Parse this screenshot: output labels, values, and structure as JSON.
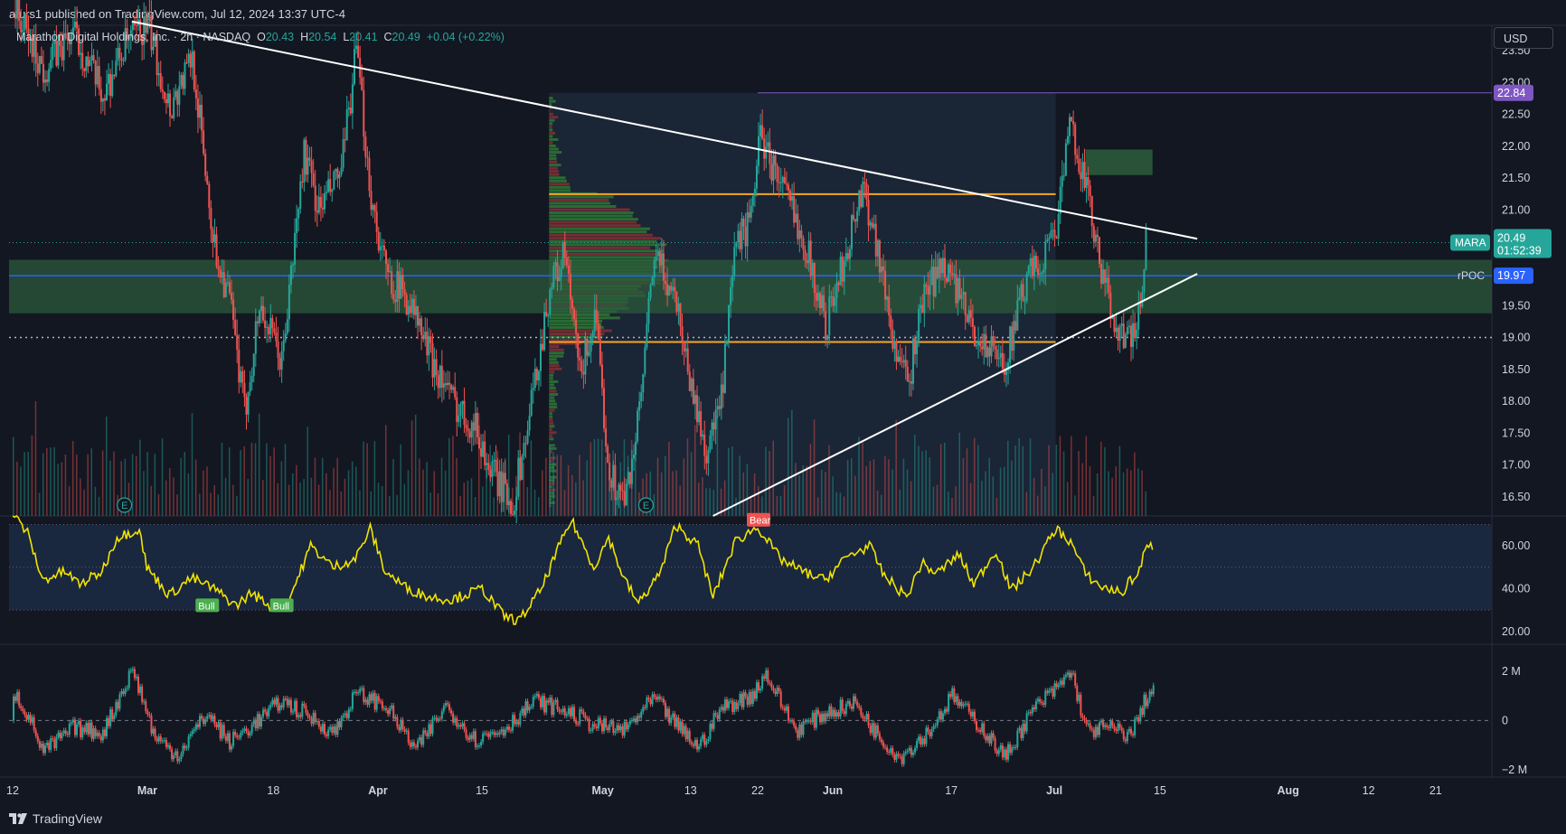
{
  "header": {
    "published": "afurs1 published on TradingView.com, Jul 12, 2024 13:37 UTC-4",
    "currency": "USD"
  },
  "legend": {
    "symbol": "Marathon Digital Holdings, Inc. · 2h · NASDAQ",
    "o_label": "O",
    "o_val": "20.43",
    "h_label": "H",
    "h_val": "20.54",
    "l_label": "L",
    "l_val": "20.41",
    "c_label": "C",
    "c_val": "20.49",
    "change": "+0.04 (+0.22%)"
  },
  "price_labels": {
    "last_symbol": "MARA",
    "last_price": "20.49",
    "countdown": "01:52:39",
    "rpoc_label": "rPOC",
    "rpoc_price": "19.97",
    "high_price": "22.84"
  },
  "rsi_labels": {
    "bull1": "Bull",
    "bull2": "Bull",
    "bear": "Bear"
  },
  "footer": {
    "brand": "TradingView"
  },
  "colors": {
    "up": "#26a69a",
    "down": "#ef5350",
    "bg": "#131722",
    "rsi": "#f2e400",
    "purple": "#7e57c2",
    "orange": "#f5a623",
    "blue": "#2962ff"
  },
  "chart_data": [
    {
      "type": "candlestick",
      "panel": "price",
      "ylim": [
        16.2,
        23.9
      ],
      "y_ticks": [
        "23.50",
        "23.00",
        "22.50",
        "22.00",
        "21.50",
        "21.00",
        "20.50",
        "20.00",
        "19.50",
        "19.00",
        "18.50",
        "18.00",
        "17.50",
        "17.00",
        "16.50"
      ],
      "y_tick_values": [
        23.5,
        23.0,
        22.5,
        22.0,
        21.5,
        21.0,
        20.5,
        20.0,
        19.5,
        19.0,
        18.5,
        18.0,
        17.5,
        17.0,
        16.5
      ],
      "x_ticks": [
        "12",
        "Mar",
        "18",
        "Apr",
        "15",
        "May",
        "13",
        "22",
        "Jun",
        "17",
        "Jul",
        "15",
        "Aug",
        "12",
        "21"
      ],
      "x_tick_dates": [
        "2024-02-12",
        "2024-03-01",
        "2024-03-18",
        "2024-04-01",
        "2024-04-15",
        "2024-05-01",
        "2024-05-13",
        "2024-05-22",
        "2024-06-01",
        "2024-06-17",
        "2024-07-01",
        "2024-07-15",
        "2024-08-01",
        "2024-08-12",
        "2024-08-21"
      ],
      "keypoints": [
        [
          "2024-02-12",
          24.2
        ],
        [
          "2024-02-16",
          23.2
        ],
        [
          "2024-02-20",
          23.8
        ],
        [
          "2024-02-24",
          22.8
        ],
        [
          "2024-02-27",
          23.6
        ],
        [
          "2024-03-01",
          23.9
        ],
        [
          "2024-03-04",
          22.6
        ],
        [
          "2024-03-07",
          23.4
        ],
        [
          "2024-03-10",
          20.4
        ],
        [
          "2024-03-12",
          19.6
        ],
        [
          "2024-03-14",
          17.8
        ],
        [
          "2024-03-16",
          19.5
        ],
        [
          "2024-03-19",
          18.6
        ],
        [
          "2024-03-22",
          21.9
        ],
        [
          "2024-03-24",
          21.0
        ],
        [
          "2024-03-27",
          21.6
        ],
        [
          "2024-03-29",
          23.5
        ],
        [
          "2024-03-31",
          21.2
        ],
        [
          "2024-04-02",
          20.0
        ],
        [
          "2024-04-05",
          19.6
        ],
        [
          "2024-04-08",
          18.7
        ],
        [
          "2024-04-11",
          18.0
        ],
        [
          "2024-04-14",
          17.6
        ],
        [
          "2024-04-16",
          16.9
        ],
        [
          "2024-04-19",
          16.4
        ],
        [
          "2024-04-21",
          17.6
        ],
        [
          "2024-04-24",
          19.8
        ],
        [
          "2024-04-26",
          20.3
        ],
        [
          "2024-04-28",
          18.4
        ],
        [
          "2024-04-30",
          19.3
        ],
        [
          "2024-05-02",
          16.9
        ],
        [
          "2024-05-04",
          16.4
        ],
        [
          "2024-05-06",
          17.8
        ],
        [
          "2024-05-08",
          20.3
        ],
        [
          "2024-05-11",
          19.6
        ],
        [
          "2024-05-13",
          18.2
        ],
        [
          "2024-05-15",
          17.2
        ],
        [
          "2024-05-17",
          18.0
        ],
        [
          "2024-05-19",
          20.5
        ],
        [
          "2024-05-21",
          20.8
        ],
        [
          "2024-05-22",
          22.2
        ],
        [
          "2024-05-25",
          21.4
        ],
        [
          "2024-05-28",
          20.6
        ],
        [
          "2024-05-31",
          19.2
        ],
        [
          "2024-06-02",
          20.0
        ],
        [
          "2024-06-05",
          21.4
        ],
        [
          "2024-06-07",
          20.4
        ],
        [
          "2024-06-09",
          19.0
        ],
        [
          "2024-06-11",
          18.2
        ],
        [
          "2024-06-13",
          19.6
        ],
        [
          "2024-06-16",
          20.2
        ],
        [
          "2024-06-19",
          19.3
        ],
        [
          "2024-06-21",
          18.9
        ],
        [
          "2024-06-24",
          18.6
        ],
        [
          "2024-06-27",
          19.9
        ],
        [
          "2024-06-29",
          20.2
        ],
        [
          "2024-07-01",
          20.8
        ],
        [
          "2024-07-03",
          22.4
        ],
        [
          "2024-07-05",
          21.3
        ],
        [
          "2024-07-07",
          20.0
        ],
        [
          "2024-07-09",
          19.2
        ],
        [
          "2024-07-11",
          18.9
        ],
        [
          "2024-07-12",
          19.3
        ],
        [
          "2024-07-13",
          20.5
        ]
      ],
      "annotations": {
        "descending_trendline": [
          [
            "2024-02-28",
            23.96
          ],
          [
            "2024-07-20",
            20.55
          ]
        ],
        "ascending_trendline": [
          [
            "2024-05-16",
            16.2
          ],
          [
            "2024-07-20",
            20.0
          ]
        ],
        "horizontal_high": {
          "value": 22.84,
          "from": "2024-05-22"
        },
        "value_area_high": {
          "value": 21.25,
          "from": "2024-04-24",
          "to": "2024-07-01"
        },
        "value_area_low": {
          "value": 18.93,
          "from": "2024-04-24",
          "to": "2024-07-01"
        },
        "rpoc": 19.97,
        "dotted_support": 19.0,
        "last_price_line": 20.49,
        "green_zone": [
          19.38,
          20.22
        ],
        "green_box": {
          "from": "2024-07-05",
          "to": "2024-07-14",
          "top": 21.95,
          "bottom": 21.55
        }
      }
    },
    {
      "type": "line",
      "panel": "RSI",
      "ylim": [
        14,
        74
      ],
      "y_ticks": [
        "60.00",
        "40.00",
        "20.00"
      ],
      "y_tick_values": [
        60,
        40,
        20
      ],
      "bands": [
        30,
        50,
        70
      ],
      "keypoints": [
        [
          "2024-02-12",
          75
        ],
        [
          "2024-02-14",
          66
        ],
        [
          "2024-02-16",
          44
        ],
        [
          "2024-02-19",
          48
        ],
        [
          "2024-02-21",
          42
        ],
        [
          "2024-02-24",
          48
        ],
        [
          "2024-02-26",
          64
        ],
        [
          "2024-02-29",
          68
        ],
        [
          "2024-03-01",
          50
        ],
        [
          "2024-03-04",
          37
        ],
        [
          "2024-03-07",
          45
        ],
        [
          "2024-03-10",
          40
        ],
        [
          "2024-03-13",
          32
        ],
        [
          "2024-03-15",
          38
        ],
        [
          "2024-03-18",
          31
        ],
        [
          "2024-03-20",
          34
        ],
        [
          "2024-03-23",
          60
        ],
        [
          "2024-03-26",
          50
        ],
        [
          "2024-03-29",
          54
        ],
        [
          "2024-03-31",
          68
        ],
        [
          "2024-04-02",
          48
        ],
        [
          "2024-04-05",
          40
        ],
        [
          "2024-04-08",
          36
        ],
        [
          "2024-04-11",
          35
        ],
        [
          "2024-04-15",
          40
        ],
        [
          "2024-04-18",
          27
        ],
        [
          "2024-04-20",
          25
        ],
        [
          "2024-04-23",
          40
        ],
        [
          "2024-04-25",
          57
        ],
        [
          "2024-04-27",
          72
        ],
        [
          "2024-04-30",
          50
        ],
        [
          "2024-05-02",
          64
        ],
        [
          "2024-05-04",
          45
        ],
        [
          "2024-05-06",
          33
        ],
        [
          "2024-05-09",
          48
        ],
        [
          "2024-05-11",
          70
        ],
        [
          "2024-05-14",
          60
        ],
        [
          "2024-05-16",
          36
        ],
        [
          "2024-05-19",
          62
        ],
        [
          "2024-05-22",
          69
        ],
        [
          "2024-05-25",
          54
        ],
        [
          "2024-05-28",
          48
        ],
        [
          "2024-05-31",
          44
        ],
        [
          "2024-06-03",
          55
        ],
        [
          "2024-06-06",
          60
        ],
        [
          "2024-06-08",
          46
        ],
        [
          "2024-06-11",
          36
        ],
        [
          "2024-06-13",
          52
        ],
        [
          "2024-06-15",
          47
        ],
        [
          "2024-06-18",
          56
        ],
        [
          "2024-06-20",
          42
        ],
        [
          "2024-06-23",
          58
        ],
        [
          "2024-06-25",
          39
        ],
        [
          "2024-06-28",
          50
        ],
        [
          "2024-07-01",
          68
        ],
        [
          "2024-07-03",
          62
        ],
        [
          "2024-07-05",
          47
        ],
        [
          "2024-07-07",
          41
        ],
        [
          "2024-07-10",
          38
        ],
        [
          "2024-07-11",
          44
        ],
        [
          "2024-07-12",
          46
        ],
        [
          "2024-07-13",
          58
        ],
        [
          "2024-07-14",
          60
        ]
      ],
      "divergence_labels": [
        [
          "2024-03-09",
          "Bull"
        ],
        [
          "2024-03-19",
          "Bull"
        ],
        [
          "2024-05-22",
          "Bear"
        ]
      ]
    },
    {
      "type": "bar",
      "panel": "oscillator",
      "ylim": [
        -2300000,
        3100000
      ],
      "y_ticks": [
        "2 M",
        "0",
        "−2 M"
      ],
      "y_tick_values": [
        2000000,
        0,
        -2000000
      ],
      "keypoints": [
        [
          "2024-02-12",
          1200000
        ],
        [
          "2024-02-14",
          200000
        ],
        [
          "2024-02-16",
          -1300000
        ],
        [
          "2024-02-20",
          -300000
        ],
        [
          "2024-02-24",
          -500000
        ],
        [
          "2024-02-28",
          2100000
        ],
        [
          "2024-03-02",
          -700000
        ],
        [
          "2024-03-05",
          -1400000
        ],
        [
          "2024-03-09",
          300000
        ],
        [
          "2024-03-12",
          -900000
        ],
        [
          "2024-03-15",
          -200000
        ],
        [
          "2024-03-19",
          800000
        ],
        [
          "2024-03-22",
          300000
        ],
        [
          "2024-03-26",
          -500000
        ],
        [
          "2024-03-29",
          1100000
        ],
        [
          "2024-04-02",
          600000
        ],
        [
          "2024-04-06",
          -1200000
        ],
        [
          "2024-04-10",
          600000
        ],
        [
          "2024-04-14",
          -800000
        ],
        [
          "2024-04-18",
          -300000
        ],
        [
          "2024-04-22",
          800000
        ],
        [
          "2024-04-26",
          400000
        ],
        [
          "2024-04-30",
          -200000
        ],
        [
          "2024-05-04",
          -400000
        ],
        [
          "2024-05-08",
          900000
        ],
        [
          "2024-05-11",
          -200000
        ],
        [
          "2024-05-14",
          -1100000
        ],
        [
          "2024-05-17",
          500000
        ],
        [
          "2024-05-21",
          1000000
        ],
        [
          "2024-05-23",
          1900000
        ],
        [
          "2024-05-27",
          -400000
        ],
        [
          "2024-05-31",
          300000
        ],
        [
          "2024-06-04",
          700000
        ],
        [
          "2024-06-07",
          -600000
        ],
        [
          "2024-06-10",
          -1500000
        ],
        [
          "2024-06-14",
          -400000
        ],
        [
          "2024-06-17",
          1000000
        ],
        [
          "2024-06-21",
          -300000
        ],
        [
          "2024-06-24",
          -1500000
        ],
        [
          "2024-06-28",
          500000
        ],
        [
          "2024-07-01",
          1300000
        ],
        [
          "2024-07-03",
          2000000
        ],
        [
          "2024-07-05",
          -400000
        ],
        [
          "2024-07-08",
          -300000
        ],
        [
          "2024-07-11",
          -600000
        ],
        [
          "2024-07-13",
          900000
        ],
        [
          "2024-07-14",
          1300000
        ]
      ]
    }
  ]
}
